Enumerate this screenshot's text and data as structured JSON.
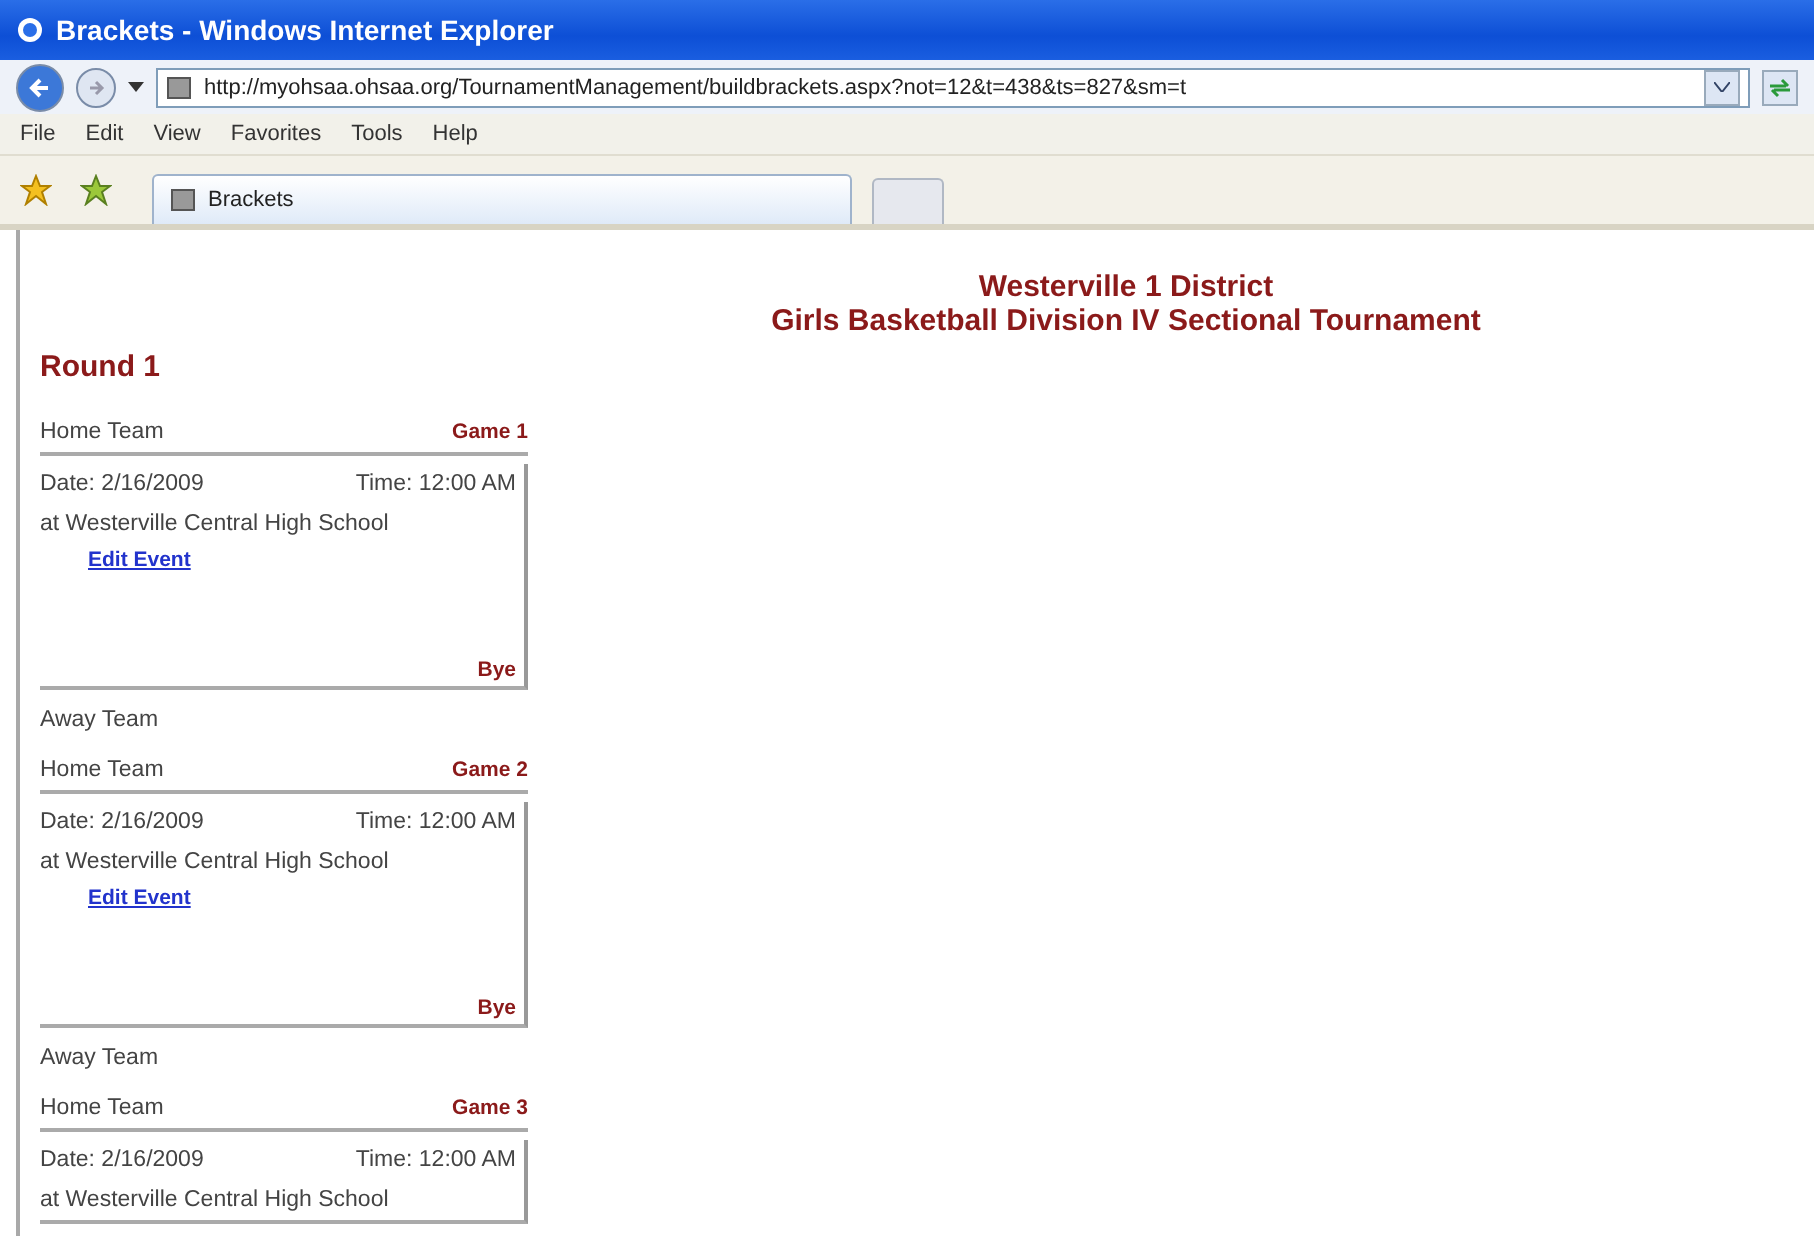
{
  "window": {
    "title": "Brackets - Windows Internet Explorer"
  },
  "address_bar": {
    "url": "http://myohsaa.ohsaa.org/TournamentManagement/buildbrackets.aspx?not=12&t=438&ts=827&sm=t"
  },
  "menu": [
    "File",
    "Edit",
    "View",
    "Favorites",
    "Tools",
    "Help"
  ],
  "tabs": [
    {
      "label": "Brackets",
      "selected": true
    }
  ],
  "page": {
    "district": "Westerville 1 District",
    "tournament": "Girls Basketball Division IV Sectional Tournament",
    "round": "Round 1",
    "games": [
      {
        "home": "Home Team",
        "game": "Game 1",
        "date": "Date: 2/16/2009",
        "time": "Time: 12:00 AM",
        "location": "at Westerville Central High School",
        "link": "Edit Event",
        "result": "Bye",
        "away": "Away Team"
      },
      {
        "home": "Home Team",
        "game": "Game 2",
        "date": "Date: 2/16/2009",
        "time": "Time: 12:00 AM",
        "location": "at Westerville Central High School",
        "link": "Edit Event",
        "result": "Bye",
        "away": "Away Team"
      },
      {
        "home": "Home Team",
        "game": "Game 3",
        "date": "Date: 2/16/2009",
        "time": "Time: 12:00 AM",
        "location": "at Westerville Central High School"
      }
    ]
  }
}
